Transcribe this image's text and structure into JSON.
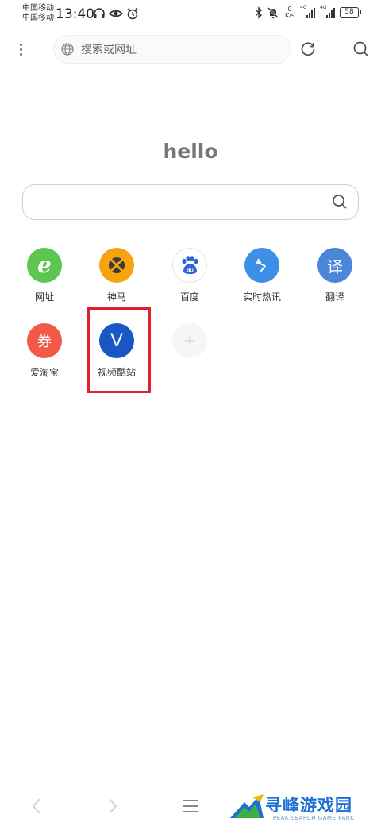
{
  "status_bar": {
    "carrier_1": "中国移动",
    "carrier_2": "中国移动",
    "time": "13:40",
    "net_speed_value": "0",
    "net_speed_unit": "K/s",
    "sim1_type": "4G",
    "sim2_type": "4G",
    "battery": "58"
  },
  "toolbar": {
    "address_placeholder": "搜索或网址"
  },
  "home": {
    "greeting": "hello"
  },
  "shortcuts": [
    {
      "label": "网址",
      "glyph": "e",
      "color": "#5cc651",
      "icon": "web-icon"
    },
    {
      "label": "神马",
      "glyph": "",
      "color": "#f5a410",
      "icon": "shenma-icon"
    },
    {
      "label": "百度",
      "glyph": "du",
      "color": "#ffffff",
      "icon": "baidu-icon"
    },
    {
      "label": "实时热讯",
      "glyph": "↰",
      "color": "#3e8fe8",
      "icon": "hot-news-icon"
    },
    {
      "label": "翻译",
      "glyph": "译",
      "color": "#4b86d9",
      "icon": "translate-icon"
    },
    {
      "label": "爱淘宝",
      "glyph": "券",
      "color": "#f25a48",
      "icon": "coupon-icon"
    },
    {
      "label": "视频酷站",
      "glyph": "V",
      "color": "#1a56c4",
      "icon": "video-site-icon"
    }
  ],
  "watermark": {
    "title": "寻峰游戏园",
    "subtitle": "PEAK SEARCH GAME PARK"
  },
  "colors": {
    "highlight": "#e0202e"
  }
}
